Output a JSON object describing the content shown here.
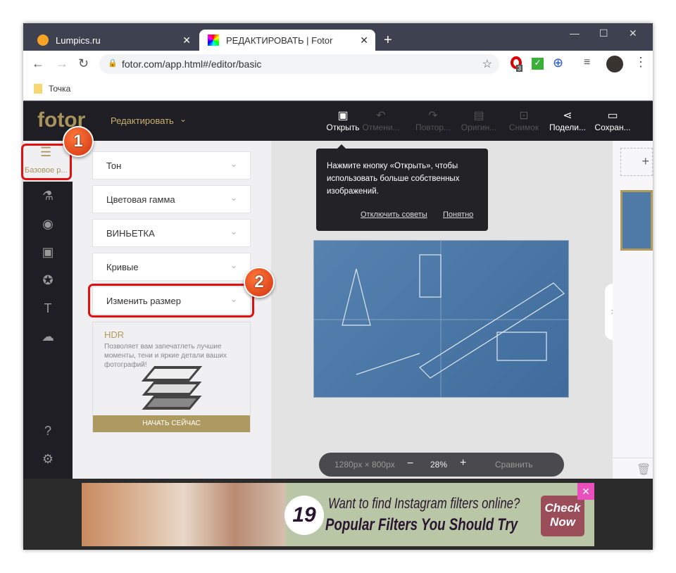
{
  "browser": {
    "tabs": [
      {
        "title": "Lumpics.ru"
      },
      {
        "title": "РЕДАКТИРОВАТЬ | Fotor"
      }
    ],
    "url": "fotor.com/app.html#/editor/basic",
    "bookmark": "Точка",
    "extension_badge": "3"
  },
  "app": {
    "logo": "fotor",
    "menu": "Редактировать",
    "toolbar": [
      "Открыть",
      "Отмени...",
      "Повтор...",
      "Оригин...",
      "Снимок",
      "Подели...",
      "Сохран..."
    ],
    "sidebar_active": "Базовое р...",
    "panel_items": [
      "Тон",
      "Цветовая гамма",
      "ВИНЬЕТКА",
      "Кривые",
      "Изменить размер"
    ],
    "hdr": {
      "title": "HDR",
      "text": "Позволяет вам запечатлеть лучшие моменты, тени и яркие детали ваших фотографий!",
      "button": "НАЧАТЬ СЕЙЧАС"
    },
    "tooltip": {
      "text": "Нажмите кнопку «Открыть», чтобы использовать больше собственных изображений.",
      "disable": "Отключить советы",
      "ok": "Понятно"
    },
    "zoombar": {
      "size": "1280px × 800px",
      "zoom": "28%",
      "compare": "Сравнить"
    }
  },
  "ad": {
    "number": "19",
    "line1": "Want to find Instagram filters online?",
    "line2": "Popular Filters You Should Try",
    "cta": "Check Now"
  },
  "callouts": [
    "1",
    "2"
  ],
  "colors": {
    "accent": "#b09a5c",
    "callout": "#e01010"
  }
}
